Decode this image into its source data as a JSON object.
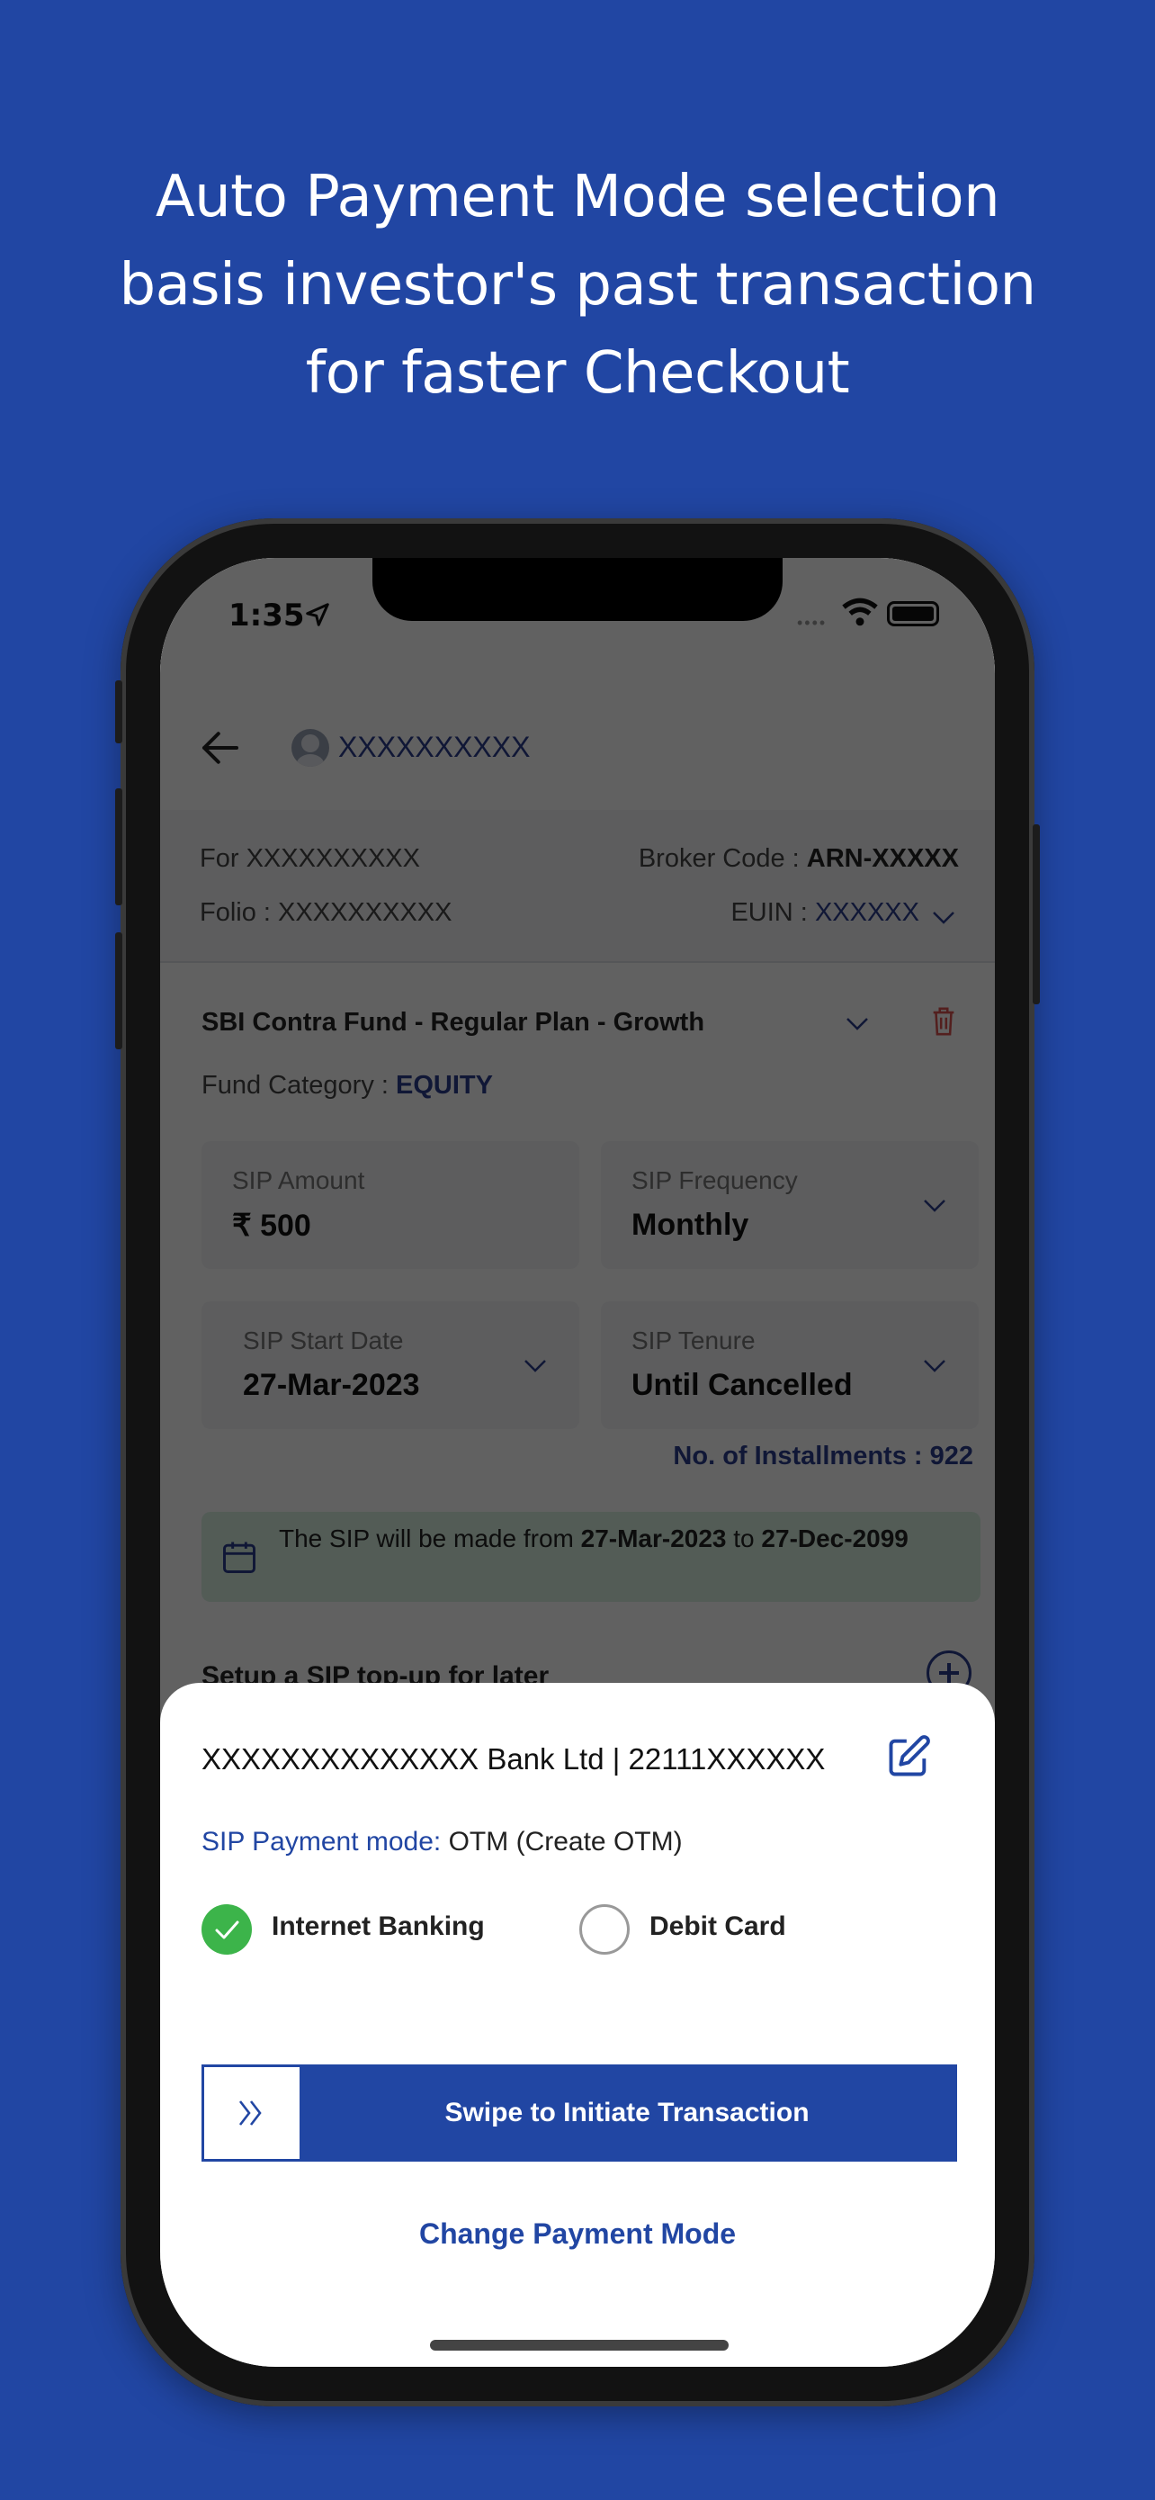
{
  "headline": {
    "lines": [
      "Auto Payment Mode selection",
      "basis investor's past transaction",
      "for faster Checkout"
    ]
  },
  "status_bar": {
    "time": "1:35",
    "icons": [
      "location-arrow-icon",
      "signal-icon",
      "wifi-icon",
      "battery-icon"
    ]
  },
  "header": {
    "back_icon": "back-arrow-icon",
    "investor_name": "XXXXXXXXXX"
  },
  "info": {
    "for_label": "For",
    "for_value": "XXXXXXXXXX",
    "broker_label": "Broker Code :",
    "broker_value": "ARN-XXXXX",
    "folio_label": "Folio :",
    "folio_value": "XXXXXXXXXX",
    "euin_label": "EUIN :",
    "euin_value": "XXXXXX"
  },
  "fund": {
    "name": "SBI Contra Fund - Regular Plan - Growth",
    "category_label": "Fund Category :",
    "category_value": "EQUITY",
    "fields": [
      {
        "label": "SIP Amount",
        "value": "₹ 500"
      },
      {
        "label": "SIP Frequency",
        "value": "Monthly"
      },
      {
        "label": "SIP Start Date",
        "value": "27-Mar-2023"
      },
      {
        "label": "SIP Tenure",
        "value": "Until Cancelled"
      }
    ],
    "installments": "No. of Installments : 922",
    "note_prefix": "The SIP will be made from",
    "note_from": "27-Mar-2023",
    "note_mid": "to",
    "note_to": "27-Dec-2099",
    "topup_label": "Setup a SIP top-up for later"
  },
  "sheet": {
    "bank_line": "XXXXXXXXXXXXXX  Bank Ltd | 22111XXXXXX",
    "pay_mode_label": "SIP Payment mode:",
    "pay_mode_value": "OTM (Create OTM)",
    "options": [
      {
        "label": "Internet Banking",
        "selected": true
      },
      {
        "label": "Debit Card",
        "selected": false
      }
    ],
    "swipe_label": "Swipe to Initiate Transaction",
    "change_mode_label": "Change Payment Mode"
  },
  "colors": {
    "brand": "#2146a3",
    "success": "#3cb44a",
    "danger": "#d9534f"
  }
}
